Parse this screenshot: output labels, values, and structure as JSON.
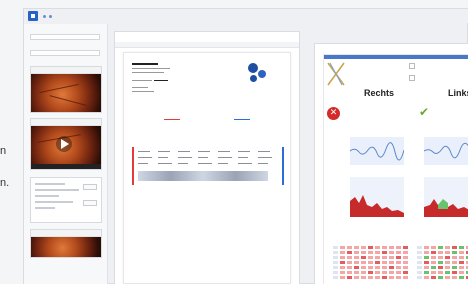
{
  "left_cut": {
    "line1": "n",
    "line2": "n."
  },
  "sidebar": {
    "labels": [
      "",
      ""
    ],
    "thumbs": [
      {
        "kind": "image"
      },
      {
        "kind": "video"
      },
      {
        "kind": "image"
      }
    ]
  },
  "doc_panel": {
    "tab_label": "",
    "doc_tab": ""
  },
  "results": {
    "right_eye": "Rechts",
    "left_eye": "Links",
    "right_status": "error",
    "left_status": "ok",
    "icons": [
      "close-icon",
      "check-icon"
    ]
  },
  "colors": {
    "accent": "#2563c9",
    "error": "#d42a2a",
    "ok": "#6aa832",
    "heat_red": "#e65b5b",
    "heat_pink": "#f2a6a6",
    "heat_green": "#69c36c"
  }
}
